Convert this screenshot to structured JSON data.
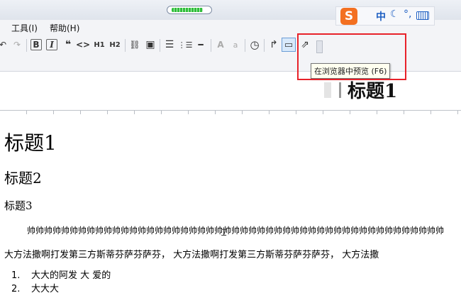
{
  "window": {
    "progress_percent": 85
  },
  "menubar": {
    "items": [
      "工具(I)",
      "帮助(H)"
    ]
  },
  "ime": {
    "logo": "S",
    "mode": "中",
    "moon": "☾",
    "punct": "°,"
  },
  "toolbar": {
    "buttons": [
      {
        "id": "undo",
        "label": "↶",
        "name": "undo-icon"
      },
      {
        "id": "redo",
        "label": "↷",
        "name": "redo-icon"
      },
      {
        "id": "bold",
        "label": "B",
        "name": "bold-icon"
      },
      {
        "id": "italic",
        "label": "I",
        "name": "italic-icon"
      },
      {
        "id": "quote",
        "label": "❝",
        "name": "blockquote-icon"
      },
      {
        "id": "code",
        "label": "<>",
        "name": "code-icon"
      },
      {
        "id": "h1",
        "label": "H1",
        "name": "heading1-icon"
      },
      {
        "id": "h2",
        "label": "H2",
        "name": "heading2-icon"
      },
      {
        "id": "link",
        "label": "⛓",
        "name": "link-icon"
      },
      {
        "id": "image",
        "label": "▣",
        "name": "image-icon"
      },
      {
        "id": "ul",
        "label": "☰",
        "name": "unordered-list-icon"
      },
      {
        "id": "ol",
        "label": "⋮☰",
        "name": "ordered-list-icon"
      },
      {
        "id": "hr",
        "label": "━",
        "name": "horizontal-rule-icon"
      },
      {
        "id": "fontup",
        "label": "A",
        "name": "font-larger-icon"
      },
      {
        "id": "fontdown",
        "label": "a",
        "name": "font-smaller-icon"
      },
      {
        "id": "clock",
        "label": "◷",
        "name": "clock-icon"
      },
      {
        "id": "wrap",
        "label": "↱",
        "name": "wrap-icon"
      },
      {
        "id": "preview",
        "label": "▭",
        "name": "preview-icon"
      },
      {
        "id": "browser",
        "label": "⇗",
        "name": "preview-in-browser-icon"
      }
    ]
  },
  "tooltip": "在浏览器中预览 (F6)",
  "preview": {
    "heading": "标题1"
  },
  "document": {
    "h1": "标题1",
    "h2": "标题2",
    "h3": "标题3",
    "para1": "帅帅帅帅帅帅帅帅帅帅帅帅帅帅帅帅帅帅帅帅帅帅帅帅帅帅帅帅帅帅帅帅帅帅帅帅帅帅帅帅帅帅帅帅帅帅帅帅帅",
    "para2": "大方法撒啊打发第三方斯蒂芬萨芬萨芬， 大方法撒啊打发第三方斯蒂芬萨芬萨芬， 大方法撒",
    "list": [
      {
        "num": "1.",
        "text": "大大的阿发 大 爱的"
      },
      {
        "num": "2.",
        "text": "大大大"
      }
    ]
  }
}
